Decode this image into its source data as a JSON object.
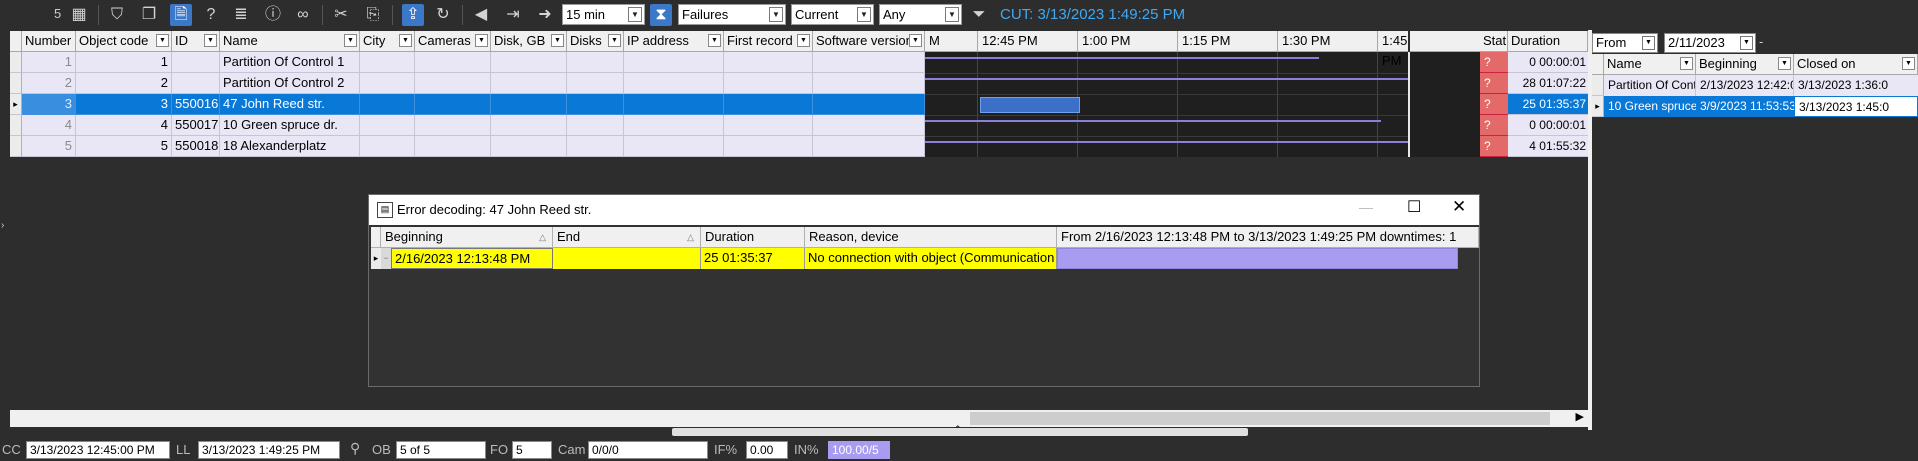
{
  "toolbar": {
    "counter": "5",
    "interval": "15 min",
    "filter": "Failures",
    "mode": "Current",
    "scope": "Any",
    "cut_label": "CUT: 3/13/2023 1:49:25 PM"
  },
  "grid": {
    "columns": [
      "Number",
      "Object code",
      "ID",
      "Name",
      "City",
      "Cameras",
      "Disk, GB",
      "Disks",
      "IP address",
      "First record",
      "Software version"
    ],
    "rows": [
      {
        "number": "1",
        "code": "1",
        "id": "",
        "name": "Partition  Of Control 1"
      },
      {
        "number": "2",
        "code": "2",
        "id": "",
        "name": "Partition  Of Control 2"
      },
      {
        "number": "3",
        "code": "3",
        "id": "550016",
        "name": "47 John Reed str."
      },
      {
        "number": "4",
        "code": "4",
        "id": "550017",
        "name": "10 Green spruce dr."
      },
      {
        "number": "5",
        "code": "5",
        "id": "550018",
        "name": "18 Alexanderplatz"
      }
    ],
    "selected_row": 3
  },
  "timeline": {
    "ticks": [
      "M",
      "12:45 PM",
      "1:00 PM",
      "1:15 PM",
      "1:30 PM",
      "1:45 PM"
    ]
  },
  "stat": {
    "stat_header": "Stat",
    "duration_header": "Duration",
    "rows": [
      {
        "stat": "?",
        "duration": "0 00:00:01"
      },
      {
        "stat": "?",
        "duration": "28 01:07:22"
      },
      {
        "stat": "?",
        "duration": "25 01:35:37"
      },
      {
        "stat": "?",
        "duration": "0 00:00:01"
      },
      {
        "stat": "?",
        "duration": "4 01:55:32"
      }
    ]
  },
  "right_panel": {
    "from_label": "From",
    "from_date": "2/11/2023",
    "dash": "-",
    "columns": [
      "Name",
      "Beginning",
      "Closed on"
    ],
    "rows": [
      {
        "name": "Partition  Of Cont",
        "beginning": "2/13/2023 12:42:03",
        "closed": "3/13/2023 1:36:0"
      },
      {
        "name": "10 Green spruce",
        "beginning": "3/9/2023 11:53:53 A",
        "closed": "3/13/2023 1:45:0"
      }
    ]
  },
  "dialog": {
    "title": "Error decoding: 47 John Reed str.",
    "columns": [
      "Beginning",
      "End",
      "Duration",
      "Reason, device"
    ],
    "range_text": "From 2/16/2023 12:13:48 PM to 3/13/2023 1:49:25 PM downtimes: 1",
    "row": {
      "beginning": "2/16/2023 12:13:48 PM",
      "end": "",
      "duration": "25 01:35:37",
      "reason": "No connection with object  (Communication"
    }
  },
  "statusbar": {
    "cc_label": "CC",
    "cc_value": "3/13/2023 12:45:00 PM",
    "ll_label": "LL",
    "ll_value": "3/13/2023 1:49:25 PM",
    "ob_label": "OB",
    "ob_value": "5 of 5",
    "fo_label": "FO",
    "fo_value": "5",
    "cam_label": "Cam",
    "cam_value": "0/0/0",
    "if_label": "IF%",
    "if_value": "0.00",
    "in_label": "IN%",
    "in_value": "100.00/5"
  },
  "colors": {
    "accent": "#3fa9f5",
    "selection": "#0a78d7",
    "failure": "#e46a6a",
    "timeline_line": "#8a7fd9",
    "highlight": "#ffff00",
    "range_bar": "#a79cf0"
  }
}
